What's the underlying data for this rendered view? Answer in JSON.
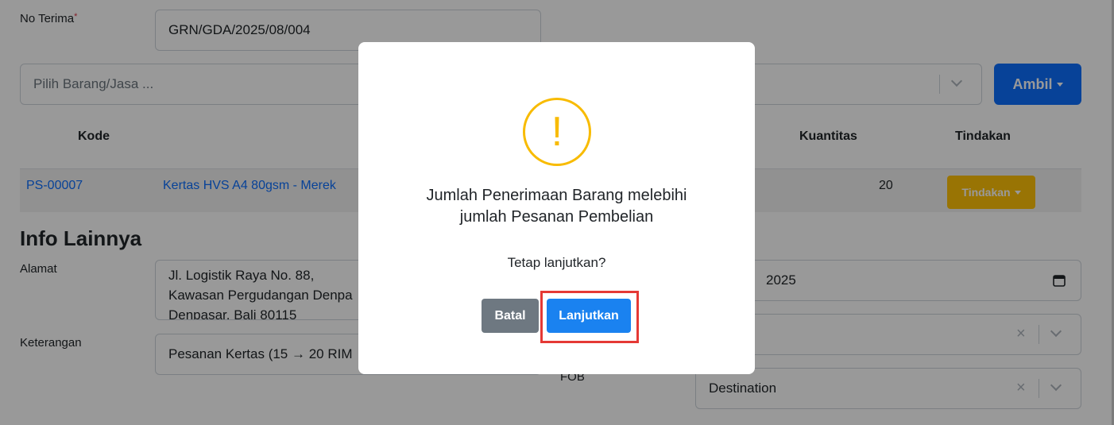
{
  "form": {
    "no_terima_label": "No Terima",
    "required_mark": "*",
    "no_terima_value": "GRN/GDA/2025/08/004",
    "item_select_placeholder": "Pilih Barang/Jasa ...",
    "ambil_button": "Ambil"
  },
  "table": {
    "headers": {
      "kode": "Kode",
      "kuantitas": "Kuantitas",
      "tindakan": "Tindakan"
    },
    "rows": [
      {
        "kode": "PS-00007",
        "nama": "Kertas HVS A4 80gsm - Merek",
        "kuantitas": "20",
        "tindakan": "Tindakan"
      }
    ]
  },
  "info": {
    "section_title": "Info Lainnya",
    "alamat_label": "Alamat",
    "alamat_value": "Jl. Logistik Raya No. 88,\nKawasan Pergudangan Denpa\nDenpasar, Bali 80115",
    "keterangan_label": "Keterangan",
    "keterangan_value": "Pesanan Kertas (15 → 20 RIM",
    "date_partial": "2025",
    "fob_label": "FOB",
    "fob_value": "Destination"
  },
  "modal": {
    "title": "Jumlah Penerimaan Barang melebihi\njumlah Pesanan Pembelian",
    "text": "Tetap lanjutkan?",
    "cancel_label": "Batal",
    "confirm_label": "Lanjutkan",
    "icon": "warning-icon"
  },
  "colors": {
    "primary": "#0d6efd",
    "warning": "#f8bb00",
    "action_button": "#ffc107",
    "cancel": "#6e7881",
    "highlight": "#e53935"
  }
}
